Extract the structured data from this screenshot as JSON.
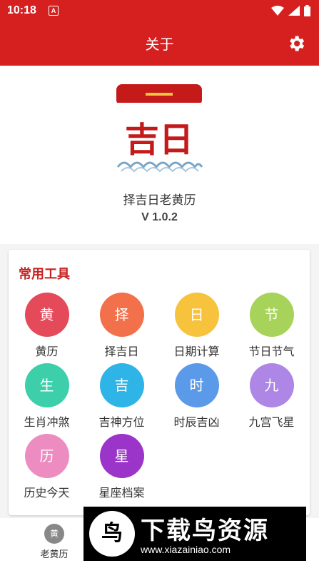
{
  "status": {
    "time": "10:18",
    "notification_icon": "A"
  },
  "appbar": {
    "title": "关于",
    "settings_icon": "gear-icon"
  },
  "about": {
    "logo_text": "吉日",
    "app_name": "择吉日老黄历",
    "version": "V 1.0.2"
  },
  "tools": {
    "title": "常用工具",
    "items": [
      {
        "glyph": "黄",
        "label": "黄历",
        "color": "#e44a5a"
      },
      {
        "glyph": "择",
        "label": "择吉日",
        "color": "#f2704a"
      },
      {
        "glyph": "日",
        "label": "日期计算",
        "color": "#f7c23c"
      },
      {
        "glyph": "节",
        "label": "节日节气",
        "color": "#a8d35a"
      },
      {
        "glyph": "生",
        "label": "生肖冲煞",
        "color": "#3ccfa9"
      },
      {
        "glyph": "吉",
        "label": "吉神方位",
        "color": "#2fb4e8"
      },
      {
        "glyph": "时",
        "label": "时辰吉凶",
        "color": "#5b9ae8"
      },
      {
        "glyph": "九",
        "label": "九宫飞星",
        "color": "#ad86e6"
      },
      {
        "glyph": "历",
        "label": "历史今天",
        "color": "#ec8cc0"
      },
      {
        "glyph": "星",
        "label": "星座档案",
        "color": "#9b34c8"
      }
    ]
  },
  "bottom_nav": {
    "label": "老黄历",
    "icon_glyph": "黄"
  },
  "banner": {
    "title": "下载鸟资源",
    "url": "www.xiazainiao.com",
    "icon_glyph": "鸟"
  }
}
